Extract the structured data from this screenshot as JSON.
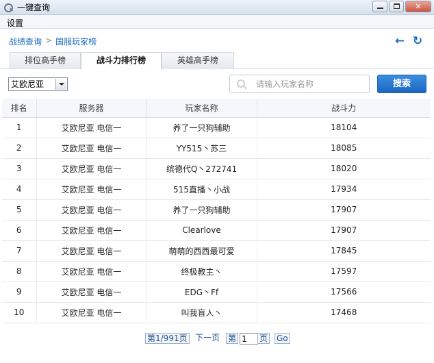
{
  "window": {
    "title": "一键查询"
  },
  "menu": {
    "settings": "设置"
  },
  "breadcrumb": {
    "root": "战绩查询",
    "separator": ">",
    "current": "国服玩家榜"
  },
  "tabs": [
    {
      "label": "排位高手榜",
      "active": false
    },
    {
      "label": "战斗力排行榜",
      "active": true
    },
    {
      "label": "英雄高手榜",
      "active": false
    }
  ],
  "filter": {
    "server_selected": "艾欧尼亚"
  },
  "search": {
    "placeholder": "请输入玩家名称",
    "button_label": "搜索"
  },
  "table": {
    "columns": [
      "排名",
      "服务器",
      "玩家名称",
      "战斗力"
    ],
    "rows": [
      {
        "rank": "1",
        "server": "艾欧尼亚 电信一",
        "player": "养了一只狗辅助",
        "power": "18104"
      },
      {
        "rank": "2",
        "server": "艾欧尼亚 电信一",
        "player": "YY515丶苏三",
        "power": "18085"
      },
      {
        "rank": "3",
        "server": "艾欧尼亚 电信一",
        "player": "缤德代Q丶272741",
        "power": "18020"
      },
      {
        "rank": "4",
        "server": "艾欧尼亚 电信一",
        "player": "515直播丶小战",
        "power": "17934"
      },
      {
        "rank": "5",
        "server": "艾欧尼亚 电信一",
        "player": "养了一只狗辅助",
        "power": "17907"
      },
      {
        "rank": "6",
        "server": "艾欧尼亚 电信一",
        "player": "Clearlove",
        "power": "17907"
      },
      {
        "rank": "7",
        "server": "艾欧尼亚 电信一",
        "player": "萌萌的西西最可爱",
        "power": "17845"
      },
      {
        "rank": "8",
        "server": "艾欧尼亚 电信一",
        "player": "终极教主丶",
        "power": "17597"
      },
      {
        "rank": "9",
        "server": "艾欧尼亚 电信一",
        "player": "EDG丶Ff",
        "power": "17566"
      },
      {
        "rank": "10",
        "server": "艾欧尼亚 电信一",
        "player": "叫我盲人丶",
        "power": "17468"
      }
    ]
  },
  "pager": {
    "status": "第1/991页",
    "next": "下一页",
    "goto_prefix": "第",
    "goto_value": "1",
    "goto_suffix": "页",
    "go": "Go"
  }
}
